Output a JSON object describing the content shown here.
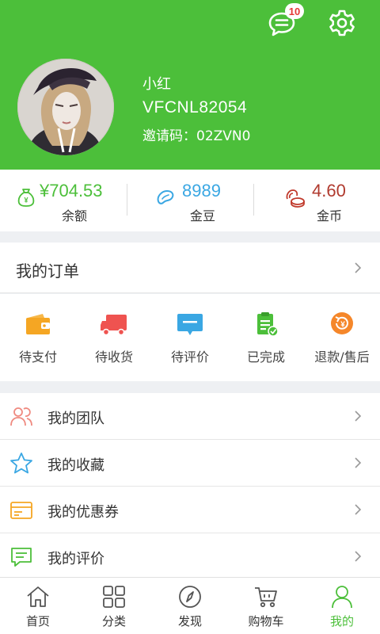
{
  "header": {
    "message_badge": "10",
    "user_name": "小红",
    "user_id": "VFCNL82054",
    "invite_label": "邀请码：",
    "invite_code": "02ZVN0"
  },
  "balances": [
    {
      "value": "¥704.53",
      "label": "余额",
      "color": "#4cbf3a",
      "icon": "money-bag-icon"
    },
    {
      "value": "8989",
      "label": "金豆",
      "color": "#3aa7e3",
      "icon": "bean-icon"
    },
    {
      "value": "4.60",
      "label": "金币",
      "color": "#c0392b",
      "icon": "coins-icon"
    }
  ],
  "orders": {
    "title": "我的订单",
    "items": [
      {
        "label": "待支付",
        "icon": "wallet-icon",
        "color": "#f5a623"
      },
      {
        "label": "待收货",
        "icon": "truck-icon",
        "color": "#ef5350"
      },
      {
        "label": "待评价",
        "icon": "comment-icon",
        "color": "#3aa7e3"
      },
      {
        "label": "已完成",
        "icon": "clipboard-check-icon",
        "color": "#4cbf3a"
      },
      {
        "label": "退款/售后",
        "icon": "refund-icon",
        "color": "#f5872a"
      }
    ]
  },
  "menu": [
    {
      "label": "我的团队",
      "icon": "team-icon"
    },
    {
      "label": "我的收藏",
      "icon": "star-icon"
    },
    {
      "label": "我的优惠券",
      "icon": "coupon-icon"
    },
    {
      "label": "我的评价",
      "icon": "review-icon"
    }
  ],
  "tabbar": [
    {
      "label": "首页",
      "icon": "home-icon"
    },
    {
      "label": "分类",
      "icon": "category-icon"
    },
    {
      "label": "发现",
      "icon": "compass-icon"
    },
    {
      "label": "购物车",
      "icon": "cart-icon"
    },
    {
      "label": "我的",
      "icon": "user-icon",
      "active": true
    }
  ],
  "colors": {
    "primary": "#4cbf3a",
    "background": "#eef0f3"
  }
}
